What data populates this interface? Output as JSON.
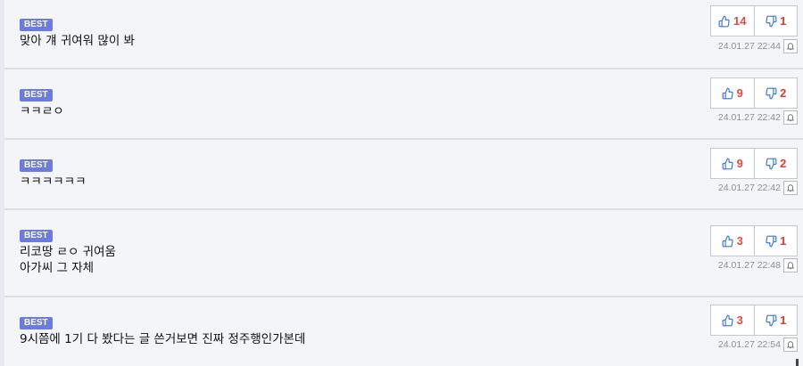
{
  "badge_label": "BEST",
  "colors": {
    "badge": "#6b7be0",
    "up_count": "#e04b41",
    "down_count": "#d93b35",
    "thumb_icon": "#3b74d1"
  },
  "comments": [
    {
      "text": "맞아 걔 귀여워 많이 봐",
      "up": "14",
      "down": "1",
      "date": "24.01.27 22:44"
    },
    {
      "text": "ㅋㅋㄹㅇ",
      "up": "9",
      "down": "2",
      "date": "24.01.27 22:42"
    },
    {
      "text": "ㅋㅋㅋㅋㅋㅋ",
      "up": "9",
      "down": "2",
      "date": "24.01.27 22:42"
    },
    {
      "text": "리코땅 ㄹㅇ 귀여움\n아가씨 그 자체",
      "up": "3",
      "down": "1",
      "date": "24.01.27 22:48"
    },
    {
      "text": "9시쯤에 1기 다 봤다는 글 쓴거보면 진짜 정주행인가본데",
      "up": "3",
      "down": "1",
      "date": "24.01.27 22:54"
    }
  ]
}
